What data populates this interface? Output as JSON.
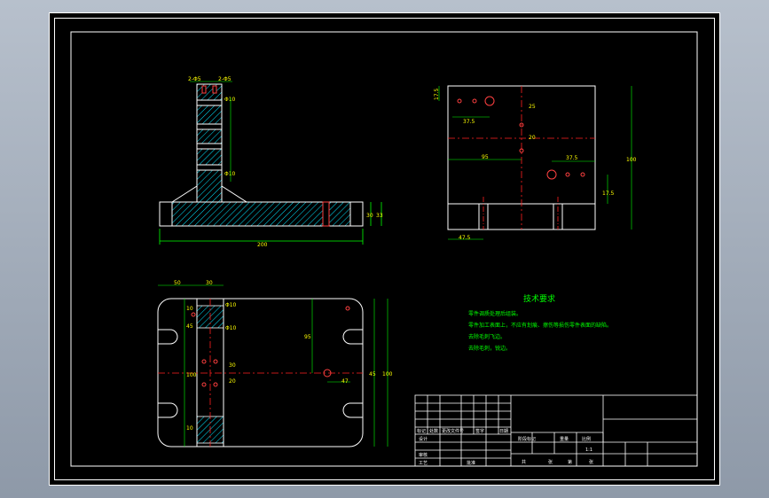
{
  "colors": {
    "background": "#000000",
    "outline": "#ffffff",
    "dimension": "#00ff00",
    "centerline": "#ff0000",
    "hatch": "#00ffff",
    "dim_text": "#ffff00",
    "hole": "#ff4040",
    "margin": "#9aa3b0"
  },
  "front_view": {
    "dims": {
      "overall_width": "200",
      "height_right_1": "30",
      "height_right_2": "33",
      "top_left": "2-Φ5",
      "top_right": "2-Φ5",
      "side_1": "Φ10",
      "side_2": "Φ10"
    }
  },
  "side_view": {
    "dims": {
      "top_offset": "17.5",
      "pitch_left": "37.5",
      "vert_1": "25",
      "vert_2": "20",
      "horiz_95": "95",
      "pitch_right": "37.5",
      "overall_height": "100",
      "right_offset": "17.5",
      "bottom_left": "47.5"
    }
  },
  "top_view": {
    "dims": {
      "top_left": "50",
      "top_mid": "30",
      "left_1": "10",
      "left_2": "45",
      "left_3": "100",
      "left_4": "10",
      "center_v": "95",
      "right_1": "45",
      "right_overall": "100",
      "bottom_1": "47",
      "side_a": "Φ10",
      "side_b": "Φ10",
      "mid_a": "30",
      "mid_b": "20"
    }
  },
  "tech_requirements": {
    "title": "技术要求",
    "lines": [
      "零件调质处理后组装。",
      "零件加工表面上，不应有划痕、擦伤等损伤零件表面的缺陷。",
      "去除毛刺飞边。",
      "去除毛刺，锐边。"
    ]
  },
  "title_block": {
    "row_labels": [
      "标记",
      "处数",
      "更改文件号",
      "签字",
      "日期"
    ],
    "design_label": "设计",
    "review_label": "审核",
    "process_label": "工艺",
    "approve_label": "批准",
    "stage_label": "阶段标记",
    "weight_label": "重量",
    "scale_label": "比例",
    "scale_value": "1:1",
    "sheet_total": "共",
    "sheet_label": "张",
    "sheet_no": "第",
    "sheet_label2": "张"
  }
}
